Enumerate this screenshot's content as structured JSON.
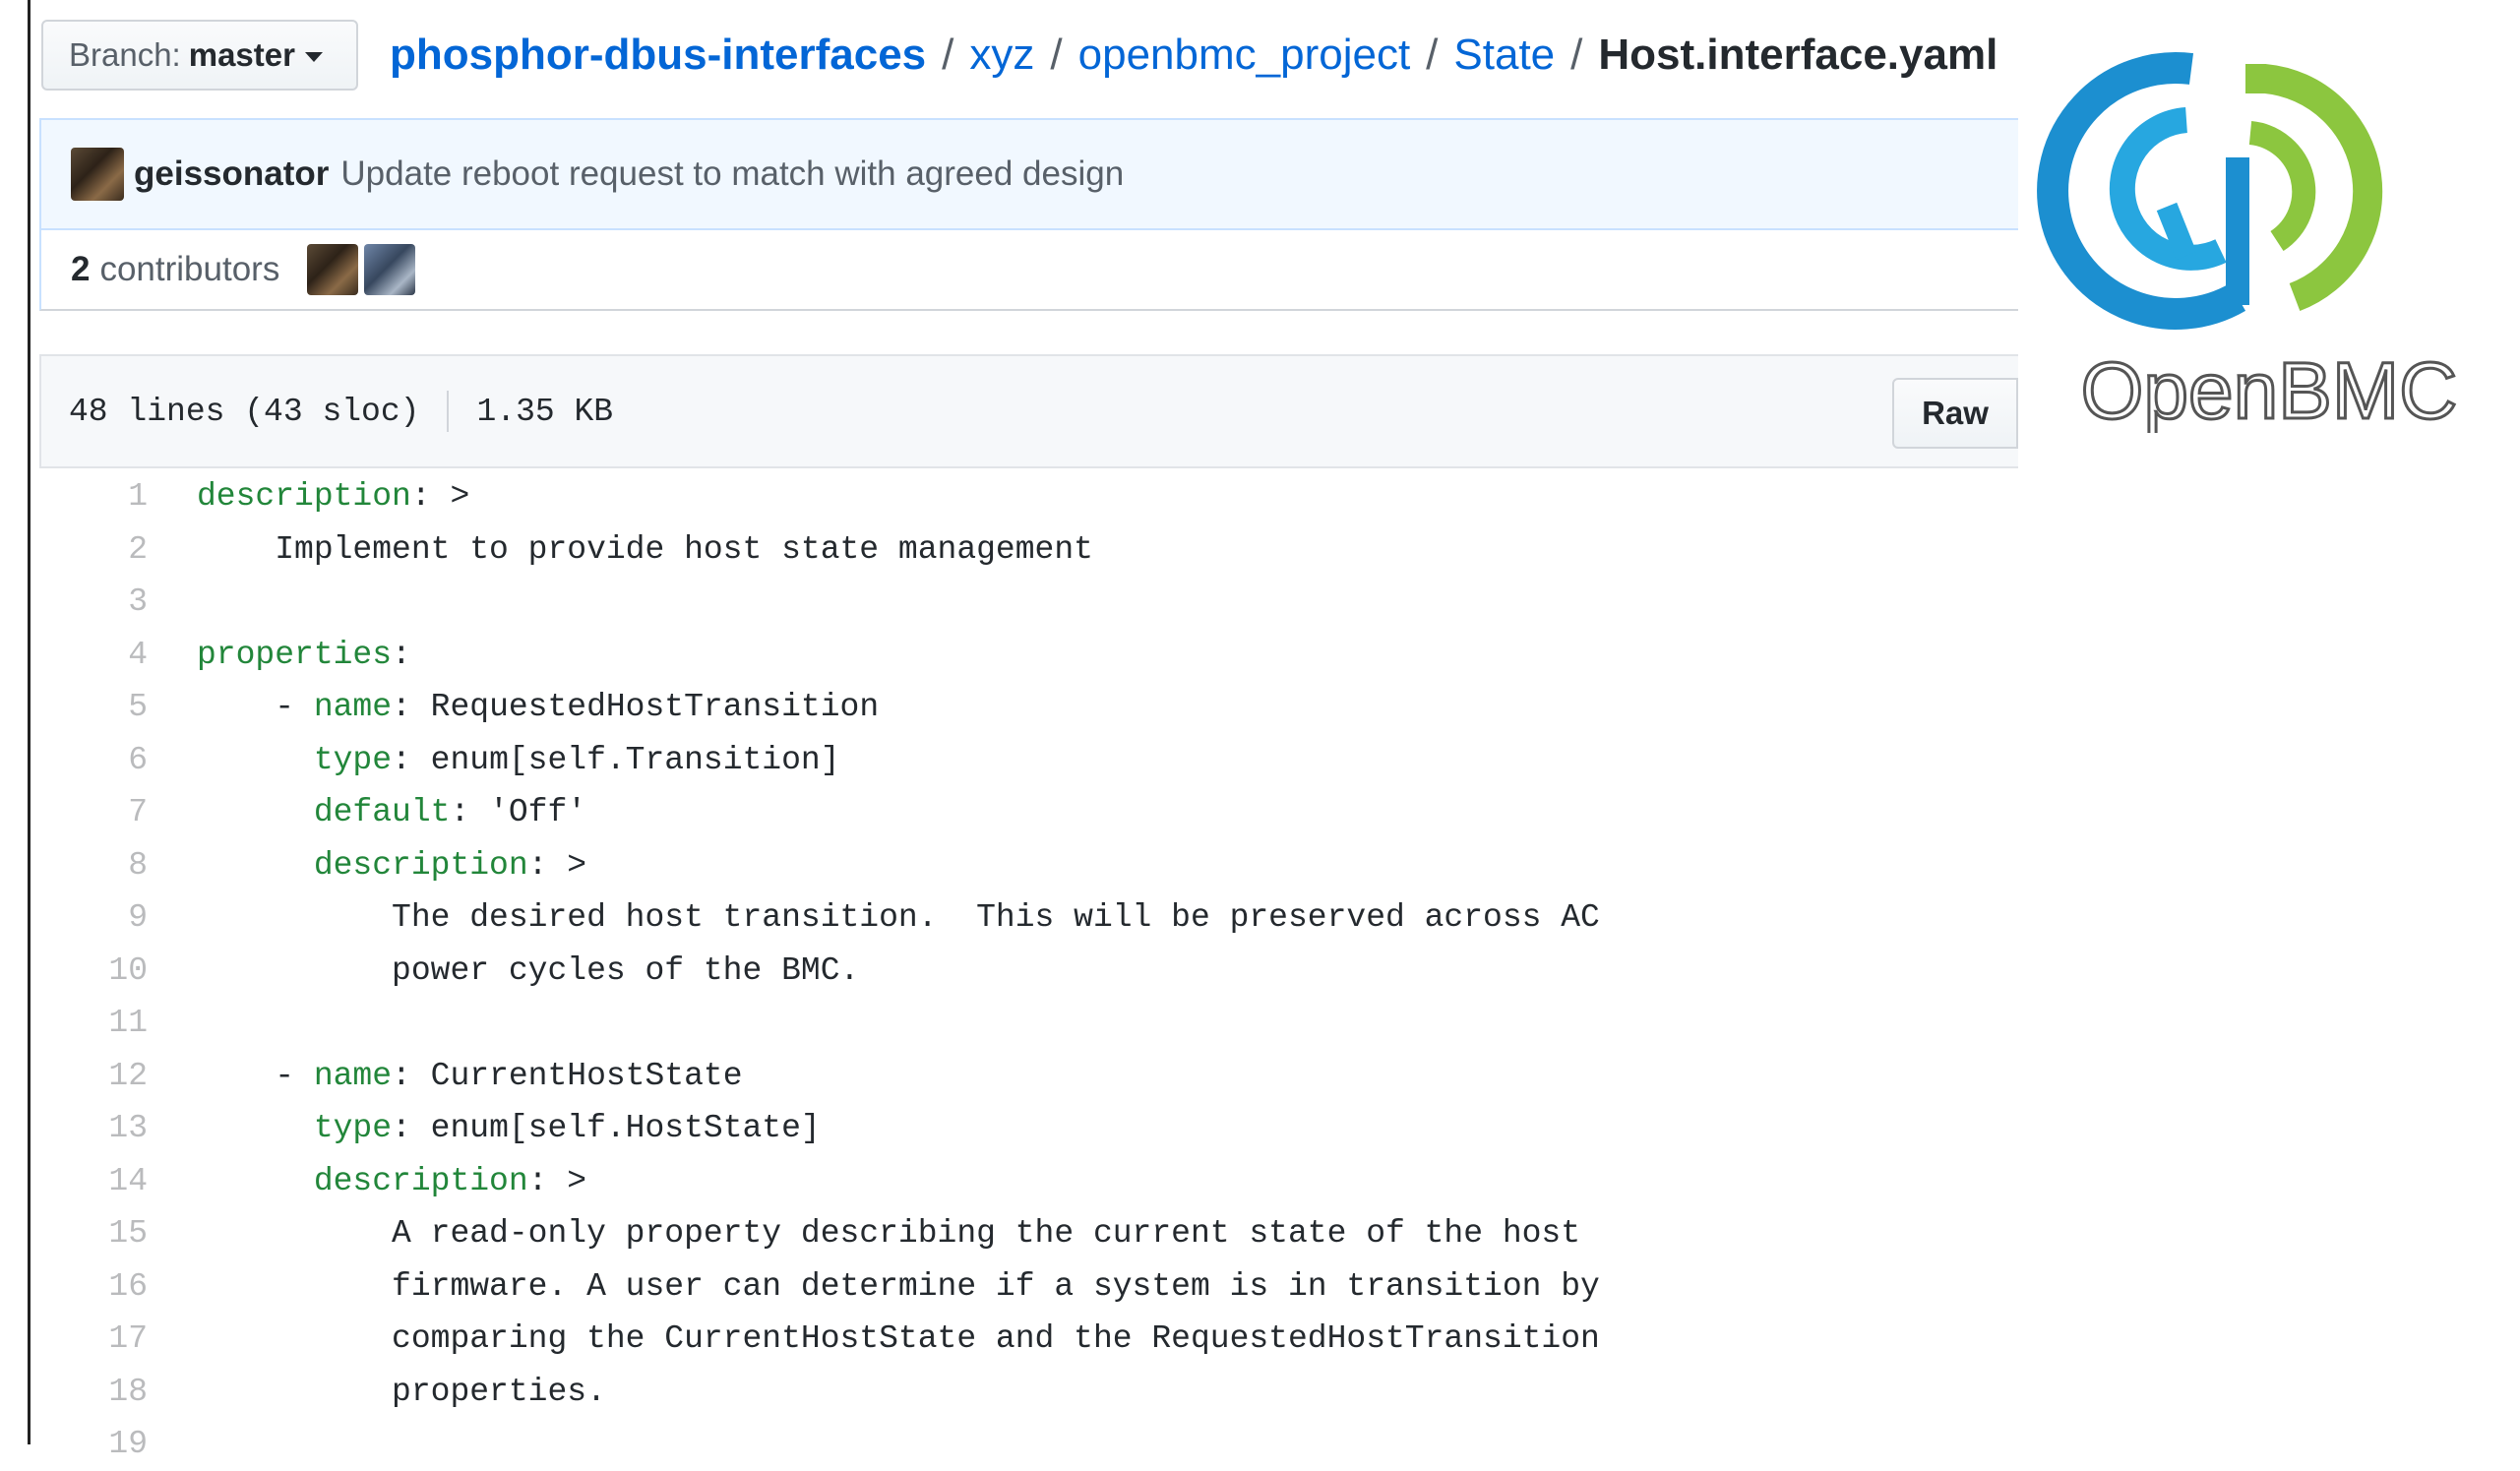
{
  "branch": {
    "label": "Branch:",
    "value": "master"
  },
  "breadcrumb": {
    "repo": "phosphor-dbus-interfaces",
    "path": [
      "xyz",
      "openbmc_project",
      "State"
    ],
    "file": "Host.interface.yaml",
    "separator": "/"
  },
  "commit": {
    "author": "geissonator",
    "message": "Update reboot request to match with agreed design"
  },
  "contributors": {
    "count": "2",
    "label": "contributors"
  },
  "file_info": {
    "lines": "48 lines (43 sloc)",
    "size": "1.35 KB",
    "raw_label": "Raw"
  },
  "logo": {
    "text": "OpenBMC"
  },
  "code_lines": [
    {
      "n": "1",
      "key": "description",
      "val": ": >"
    },
    {
      "n": "2",
      "key": "",
      "val": "    Implement to provide host state management"
    },
    {
      "n": "3",
      "key": "",
      "val": ""
    },
    {
      "n": "4",
      "key": "properties",
      "val": ":"
    },
    {
      "n": "5",
      "key": "name",
      "val": ": RequestedHostTransition",
      "dash": true
    },
    {
      "n": "6",
      "key": "type",
      "val": ": enum[self.Transition]",
      "indent": "      "
    },
    {
      "n": "7",
      "key": "default",
      "val": ": 'Off'",
      "indent": "      "
    },
    {
      "n": "8",
      "key": "description",
      "val": ": >",
      "indent": "      "
    },
    {
      "n": "9",
      "key": "",
      "val": "          The desired host transition.  This will be preserved across AC"
    },
    {
      "n": "10",
      "key": "",
      "val": "          power cycles of the BMC."
    },
    {
      "n": "11",
      "key": "",
      "val": ""
    },
    {
      "n": "12",
      "key": "name",
      "val": ": CurrentHostState",
      "dash": true
    },
    {
      "n": "13",
      "key": "type",
      "val": ": enum[self.HostState]",
      "indent": "      "
    },
    {
      "n": "14",
      "key": "description",
      "val": ": >",
      "indent": "      "
    },
    {
      "n": "15",
      "key": "",
      "val": "          A read-only property describing the current state of the host"
    },
    {
      "n": "16",
      "key": "",
      "val": "          firmware. A user can determine if a system is in transition by"
    },
    {
      "n": "17",
      "key": "",
      "val": "          comparing the CurrentHostState and the RequestedHostTransition"
    },
    {
      "n": "18",
      "key": "",
      "val": "          properties."
    },
    {
      "n": "19",
      "key": "",
      "val": ""
    }
  ]
}
